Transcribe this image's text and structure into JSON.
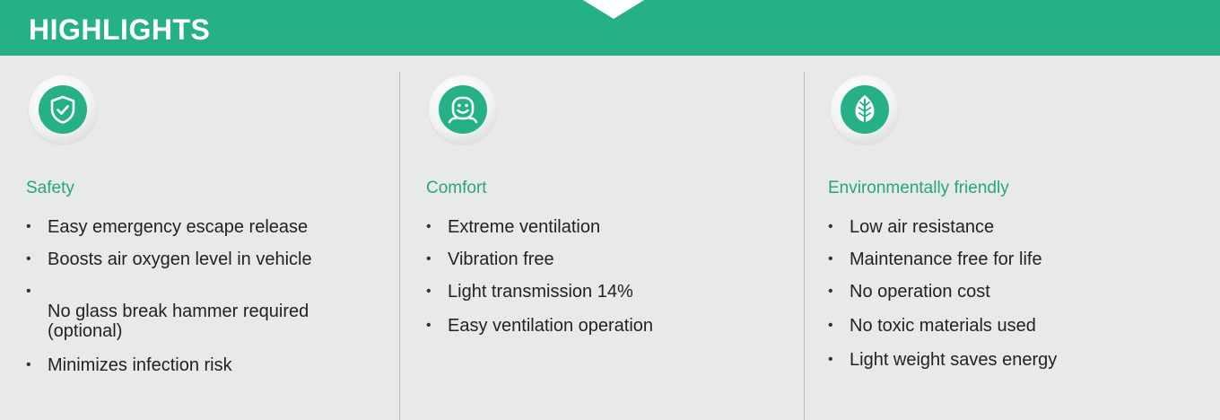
{
  "header": {
    "title": "HIGHLIGHTS"
  },
  "colors": {
    "accent": "#26b087",
    "title_green": "#26a57f",
    "background": "#e8eaea",
    "text": "#222222"
  },
  "columns": [
    {
      "icon": "shield-check-icon",
      "title": "Safety",
      "items": [
        "Easy emergency escape release",
        "Boosts air oxygen level in vehicle",
        "No glass break hammer required\n(optional)",
        "Minimizes infection risk"
      ]
    },
    {
      "icon": "smiley-face-icon",
      "title": "Comfort",
      "items": [
        "Extreme ventilation",
        "Vibration free",
        "Light transmission 14%",
        "Easy ventilation operation"
      ]
    },
    {
      "icon": "leaf-icon",
      "title": "Environmentally friendly",
      "items": [
        "Low air resistance",
        "Maintenance free for life",
        "No operation cost",
        "No toxic materials used",
        "Light weight saves energy"
      ]
    }
  ]
}
